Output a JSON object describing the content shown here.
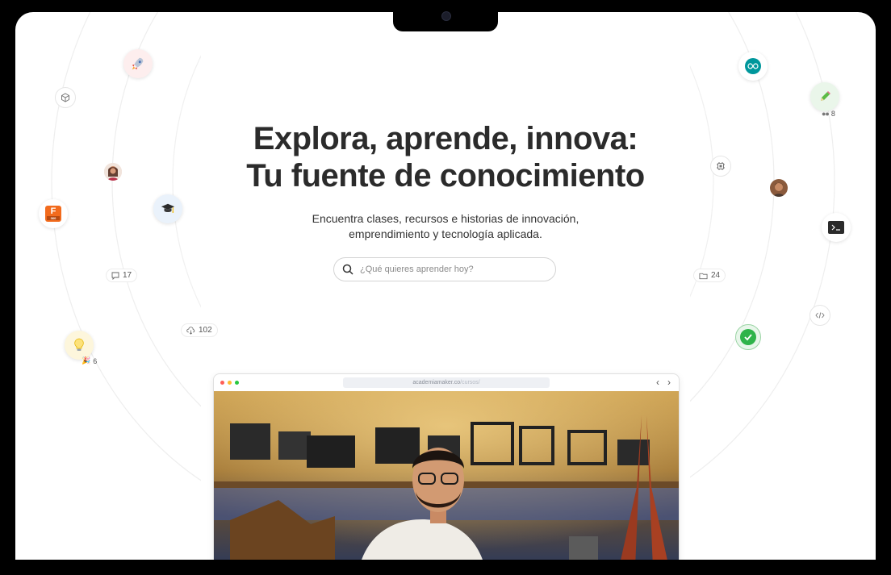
{
  "hero": {
    "title_line1": "Explora, aprende, innova:",
    "title_line2": "Tu fuente de conocimiento",
    "subtitle_line1": "Encuentra clases, recursos e historias de innovación,",
    "subtitle_line2": "emprendimiento y tecnología aplicada."
  },
  "search": {
    "placeholder": "¿Qué quieres aprender hoy?"
  },
  "floating_badges": {
    "comments": "17",
    "downloads": "102",
    "ideas": "6",
    "folders": "24",
    "users": "8",
    "fusion_label": "F",
    "fusion_sub": "360"
  },
  "browser": {
    "url_domain": "academiamaker.co",
    "url_path": "/cursos/",
    "back": "‹",
    "forward": "›"
  },
  "icons": [
    "rocket-icon",
    "cube-icon",
    "avatar-woman",
    "fusion360-icon",
    "graduation-cap-icon",
    "lightbulb-icon",
    "chat-icon",
    "cloud-download-icon",
    "arduino-icon",
    "pencil-icon",
    "chip-icon",
    "avatar-man",
    "terminal-icon",
    "code-icon",
    "check-icon",
    "folder-icon"
  ],
  "colors": {
    "accent_green": "#2fb34a",
    "arduino": "#00979c",
    "fusion": "#f26b1d",
    "title": "#2b2b2b"
  }
}
